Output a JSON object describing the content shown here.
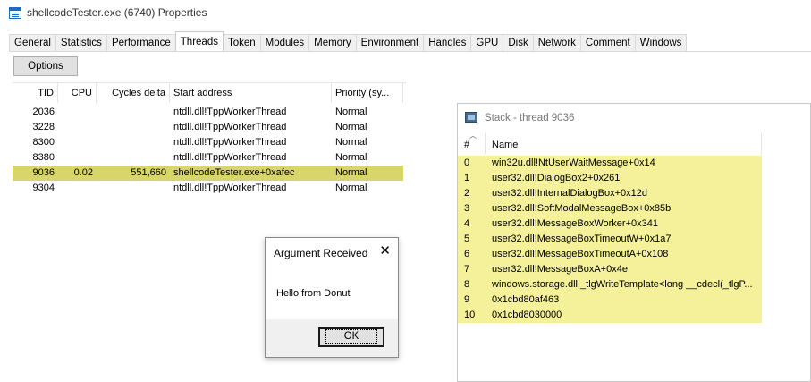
{
  "window": {
    "title": "shellcodeTester.exe (6740) Properties"
  },
  "tabs": [
    "General",
    "Statistics",
    "Performance",
    "Threads",
    "Token",
    "Modules",
    "Memory",
    "Environment",
    "Handles",
    "GPU",
    "Disk",
    "Network",
    "Comment",
    "Windows"
  ],
  "active_tab": "Threads",
  "toolbar": {
    "options_label": "Options"
  },
  "threads": {
    "columns": {
      "tid": "TID",
      "cpu": "CPU",
      "cycles": "Cycles delta",
      "start": "Start address",
      "priority": "Priority (sy..."
    },
    "rows": [
      {
        "tid": "2036",
        "cpu": "",
        "cycles": "",
        "start": "ntdll.dll!TppWorkerThread",
        "priority": "Normal"
      },
      {
        "tid": "3228",
        "cpu": "",
        "cycles": "",
        "start": "ntdll.dll!TppWorkerThread",
        "priority": "Normal"
      },
      {
        "tid": "8300",
        "cpu": "",
        "cycles": "",
        "start": "ntdll.dll!TppWorkerThread",
        "priority": "Normal"
      },
      {
        "tid": "8380",
        "cpu": "",
        "cycles": "",
        "start": "ntdll.dll!TppWorkerThread",
        "priority": "Normal"
      },
      {
        "tid": "9036",
        "cpu": "0.02",
        "cycles": "551,660",
        "start": "shellcodeTester.exe+0xafec",
        "priority": "Normal"
      },
      {
        "tid": "9304",
        "cpu": "",
        "cycles": "",
        "start": "ntdll.dll!TppWorkerThread",
        "priority": "Normal"
      }
    ],
    "highlight_color": "#d8d56a"
  },
  "stack": {
    "title": "Stack - thread 9036",
    "columns": {
      "num": "#",
      "name": "Name"
    },
    "rows": [
      {
        "num": "0",
        "name": "win32u.dll!NtUserWaitMessage+0x14"
      },
      {
        "num": "1",
        "name": "user32.dll!DialogBox2+0x261"
      },
      {
        "num": "2",
        "name": "user32.dll!InternalDialogBox+0x12d"
      },
      {
        "num": "3",
        "name": "user32.dll!SoftModalMessageBox+0x85b"
      },
      {
        "num": "4",
        "name": "user32.dll!MessageBoxWorker+0x341"
      },
      {
        "num": "5",
        "name": "user32.dll!MessageBoxTimeoutW+0x1a7"
      },
      {
        "num": "6",
        "name": "user32.dll!MessageBoxTimeoutA+0x108"
      },
      {
        "num": "7",
        "name": "user32.dll!MessageBoxA+0x4e"
      },
      {
        "num": "8",
        "name": "windows.storage.dll!_tlgWriteTemplate<long __cdecl(_tlgP..."
      },
      {
        "num": "9",
        "name": "0x1cbd80af463"
      },
      {
        "num": "10",
        "name": "0x1cbd8030000"
      }
    ],
    "row_color": "#f4f19a"
  },
  "message_box": {
    "title": "Argument Received",
    "close_glyph": "✕",
    "text": "Hello from Donut",
    "ok_label": "OK"
  }
}
